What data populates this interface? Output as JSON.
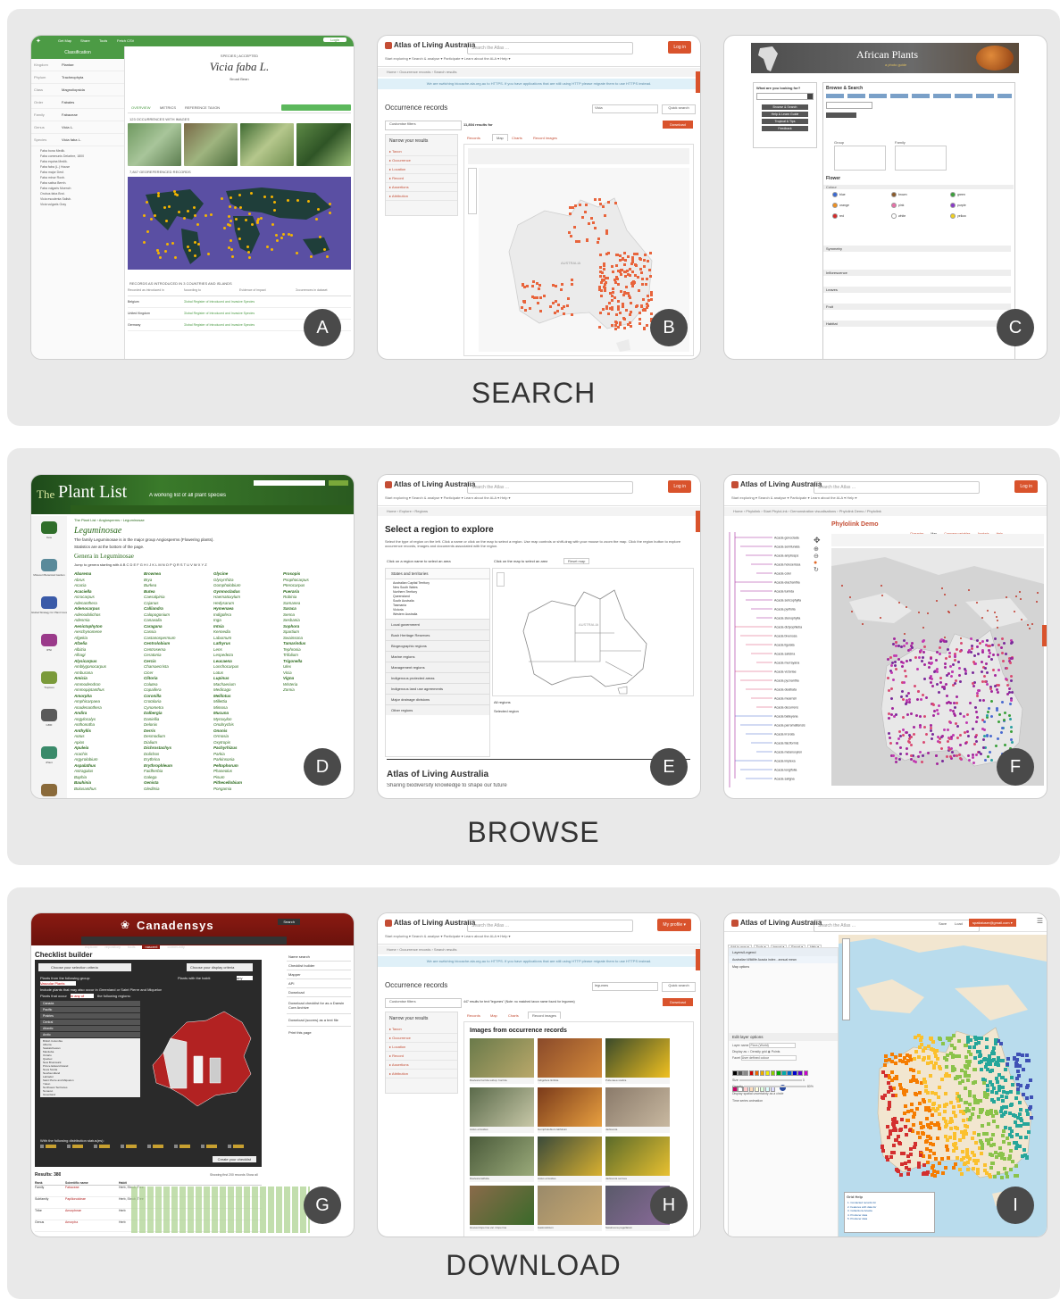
{
  "sections": [
    {
      "caption": "SEARCH"
    },
    {
      "caption": "BROWSE"
    },
    {
      "caption": "DOWNLOAD"
    }
  ],
  "badges": [
    "A",
    "B",
    "C",
    "D",
    "E",
    "F",
    "G",
    "H",
    "I"
  ],
  "A": {
    "toolbar_items": [
      "Get Map",
      "Share",
      "Tools",
      "Fetch CSV"
    ],
    "login_label": "Login",
    "classification_title": "Classification",
    "rank_rows": [
      "Kingdom",
      "Phylum",
      "Class",
      "Order",
      "Family",
      "Genus",
      "Species"
    ],
    "rank_values": [
      "Plantae",
      "Tracheophyta",
      "Magnoliopsida",
      "Fabales",
      "Fabaceae",
      "Vicia L.",
      "Vicia faba L."
    ],
    "status": "SPECIES | ACCEPTED",
    "species_title": "Vicia faba L.",
    "subtitle": "Broad Bean",
    "tabs": [
      "OVERVIEW",
      "METRICS",
      "REFERENCE TAXON"
    ],
    "section_images": "123 OCCURRENCES WITH IMAGES",
    "section_map": "7,847 GEOREFERENCED RECORDS",
    "section_table": "RECORDS AS INTRODUCED IN 3 COUNTRIES AND ISLANDS",
    "table_header": [
      "Recorded as introduced in",
      "According to",
      "Evidence of impact",
      "Occurrences in dataset"
    ],
    "table_rows": [
      [
        "Belgium",
        "Global Register of Introduced and Invasive Species"
      ],
      [
        "United Kingdom",
        "Global Register of Introduced and Invasive Species"
      ],
      [
        "Germany",
        "Global Register of Introduced and Invasive Species"
      ]
    ],
    "synonym_list": [
      "Faba bona Medik.",
      "Faba communis Delarbre, 1800",
      "Faba equina Medik.",
      "Faba faba (L.) House",
      "Faba major Desf.",
      "Faba minor Roxb.",
      "Faba sativa Bernh.",
      "Faba vulgaris Moench",
      "Orobus faba Brot.",
      "Vicia esculenta Salisb.",
      "Vicia vulgaris Gray"
    ]
  },
  "B": {
    "logo": "Atlas of Living Australia",
    "search_placeholder": "Search the Atlas ...",
    "login_btn": "Log in",
    "nav": "Start exploring ▾   Search & analyse ▾   Participate ▾   Learn about the ALA ▾   Help ▾",
    "crumb": "Home  ›  Occurrence records  ›  Search results",
    "notice": "We are switching biocache.ala.org.au to HTTPS. If you have applications that are still using HTTP please migrate them to use HTTPS instead.",
    "title": "Occurrence records",
    "search_value": "Vicia",
    "quick_search": "Quick search",
    "customise": "Customise filters",
    "results": "11,804 results for",
    "download": "Download",
    "narrow": "Narrow your results",
    "facets": [
      "Taxon",
      "Occurrence",
      "Location",
      "Record",
      "Assertions",
      "Attribution"
    ],
    "tabs": [
      "Records",
      "Map",
      "Charts",
      "Record images"
    ],
    "map_label": "AUSTRALIA"
  },
  "C": {
    "banner": "African Plants",
    "banner_sub": "a photo guide",
    "question": "What are you looking for?",
    "buttons": [
      "Browse & Search",
      "Help & Learn Guide",
      "Tropical & Tips",
      "Feedback"
    ],
    "browse_title": "Browse & Search",
    "group_label": "Group",
    "family_label": "Family",
    "flower_label": "Flower",
    "colour_label": "Colour",
    "colours": [
      "blue",
      "brown",
      "green",
      "orange",
      "pink",
      "purple",
      "red",
      "white",
      "yellow"
    ],
    "rows": [
      "Symmetry",
      "Inflorescence",
      "Leaves",
      "Fruit",
      "Habitat"
    ],
    "fruit_label": "Fruit"
  },
  "D": {
    "title_the": "The",
    "title_main": "Plant List",
    "tagline": "A working list of all plant species",
    "nav": [
      "Home",
      "About",
      "Browse",
      "Statistics",
      "Feedback",
      "How to use this site"
    ],
    "crumb": "The Plant List  ›  Angiosperms  ›  Leguminosae",
    "family": "Leguminosae",
    "family_desc": "The family Leguminosae is in the major group Angiosperms (Flowering plants).",
    "stats": "Statistics are at the bottom of the page.",
    "genera_title": "Genera in Leguminosae",
    "jump": "Jump to genera starting with A B C D E F G H I J K L M N O P Q R S T U V W X Y Z",
    "genera_cols": [
      [
        "Abarema",
        "Abrus",
        "Acacia",
        "Acaciella",
        "Acrocarpus",
        "Adenanthera",
        "Adenocarpus",
        "Adenodolichos",
        "Adesmia",
        "Aenictophyton",
        "Aeschynomene",
        "Afgekia",
        "Afzelia",
        "Albizia",
        "Alhagi",
        "Alysicarpus",
        "Amblygonocarpus",
        "Amburana",
        "Amicia",
        "Ammodendron",
        "Ammopiptanthus",
        "Amorpha",
        "Amphicarpaea",
        "Anadenanthera",
        "Andira",
        "Angylocalyx",
        "Anthonotha",
        "Anthyllis",
        "Aotus",
        "Apios",
        "Apuleia",
        "Arachis",
        "Argyrolobium",
        "Aspalathus",
        "Astragalus",
        "Baphia",
        "Bauhinia",
        "Bolusanthus"
      ],
      [
        "Brownea",
        "Brya",
        "Burkea",
        "Butea",
        "Caesalpinia",
        "Cajanus",
        "Calliandra",
        "Calopogonium",
        "Canavalia",
        "Caragana",
        "Cassia",
        "Castanospermum",
        "Centrolobium",
        "Centrosema",
        "Ceratonia",
        "Cercis",
        "Chamaecrista",
        "Cicer",
        "Clitoria",
        "Colutea",
        "Copaifera",
        "Coronilla",
        "Crotalaria",
        "Cynometra",
        "Dalbergia",
        "Daniellia",
        "Delonix",
        "Derris",
        "Desmodium",
        "Dialium",
        "Dichrostachys",
        "Dolichos",
        "Erythrina",
        "Erythrophleum",
        "Faidherbia",
        "Galega",
        "Genista",
        "Gleditsia"
      ],
      [
        "Glycine",
        "Glycyrrhiza",
        "Gompholobium",
        "Gymnocladus",
        "Haematoxylum",
        "Hedysarum",
        "Hymenaea",
        "Indigofera",
        "Inga",
        "Intsia",
        "Kennedia",
        "Laburnum",
        "Lathyrus",
        "Lens",
        "Lespedeza",
        "Leucaena",
        "Lonchocarpus",
        "Lotus",
        "Lupinus",
        "Machaerium",
        "Medicago",
        "Melilotus",
        "Millettia",
        "Mimosa",
        "Mucuna",
        "Myroxylon",
        "Onobrychis",
        "Ononis",
        "Ormosia",
        "Oxytropis",
        "Pachyrhizus",
        "Parkia",
        "Parkinsonia",
        "Peltophorum",
        "Phaseolus",
        "Pisum",
        "Pithecellobium",
        "Pongamia"
      ],
      [
        "Prosopis",
        "Psophocarpus",
        "Pterocarpus",
        "Pueraria",
        "Robinia",
        "Samanea",
        "Saraca",
        "Senna",
        "Sesbania",
        "Sophora",
        "Spartium",
        "Swainsona",
        "Tamarindus",
        "Tephrosia",
        "Trifolium",
        "Trigonella",
        "Ulex",
        "Vicia",
        "Vigna",
        "Wisteria",
        "Zornia"
      ]
    ],
    "sidebar_labels": [
      "Kew",
      "Missouri Botanical Garden",
      "Global Strategy for Plant Conservation",
      "IPNI",
      "Tropicos",
      "GBIF",
      "iPlant",
      "CBD"
    ]
  },
  "E": {
    "logo": "Atlas of Living Australia",
    "search_placeholder": "Search the Atlas ...",
    "login_btn": "Log in",
    "nav": "Start exploring ▾   Search & analyse ▾   Participate ▾   Learn about the ALA ▾   Help ▾",
    "crumb": "Home  ›  Explore  ›  Regions",
    "title": "Select a region to explore",
    "desc": "Select the type of region on the left. Click a name or click on the map to select a region. Use map controls or shift-drag with your mouse to zoom the map. Click the region button to explore occurrence records, images and documents associated with the region.",
    "radio1": "Click on a region name to select an area",
    "radio2": "Click on the map to select an area",
    "reset": "Reset map",
    "group_open": "States and territories",
    "states": [
      "Australian Capital Territory",
      "New South Wales",
      "Northern Territory",
      "Queensland",
      "South Australia",
      "Tasmania",
      "Victoria",
      "Western Australia"
    ],
    "groups": [
      "Local government",
      "Bush Heritage Reserves",
      "Biogeographic regions",
      "Marine regions",
      "Management regions",
      "Indigenous protected areas",
      "Indigenous land use agreements",
      "Major drainage divisions",
      "Other regions"
    ],
    "layer1": "All regions",
    "layer2": "Selected region",
    "footer_title": "Atlas of Living Australia",
    "footer_sub": "Sharing biodiversity knowledge to shape our future",
    "map_label": "AUSTRALIA"
  },
  "F": {
    "logo": "Atlas of Living Australia",
    "search_placeholder": "Search the Atlas ...",
    "login_btn": "Log in",
    "nav": "Start exploring ▾   Search & analyse ▾   Participate ▾   Learn about the ALA ▾   Help ▾",
    "crumb": "Home  ›  Phylolink  ›  Start PhyloLink  ›  Demonstration visualisations  ›  Phylolink Demo / Phylolink",
    "demo_title": "Phylolink Demo",
    "tabs": [
      "Character",
      "Map",
      "Compare variables",
      "Analysis",
      "Help"
    ],
    "tree_labels": [
      "Acacia gonoclada",
      "Acacia semilunata",
      "Acacia ampliceps",
      "Acacia holosericea",
      "Acacia colei",
      "Acacia elachantha",
      "Acacia tumida",
      "Acacia sericophylla",
      "Acacia pyrifolia",
      "Acacia stenophylla",
      "Acacia dictyophleba",
      "Acacia bivenosa",
      "Acacia ligulata",
      "Acacia salicina",
      "Acacia murrayana",
      "Acacia victoriae",
      "Acacia pycnantha",
      "Acacia dealbata",
      "Acacia mearnsii",
      "Acacia decurrens",
      "Acacia baileyana",
      "Acacia parramattensis",
      "Acacia irrorata",
      "Acacia falciformis",
      "Acacia melanoxylon",
      "Acacia implexa",
      "Acacia longifolia",
      "Acacia saligna"
    ]
  },
  "G": {
    "brand": "Canadensys",
    "search_btn": "Search",
    "nav": [
      "explorer",
      "repository",
      "tools",
      "nascent",
      "community"
    ],
    "title": "Checklist builder",
    "step1": "Choose your selection criteria",
    "step2": "Choose your display criteria",
    "plants_group": "Plants from the following group:",
    "group_value": "Vascular Plants",
    "habit": "Plants with the habit:",
    "habit_value": "any",
    "include": "Include plants that may also occur in Greenland or Saint Pierre and Miquelon",
    "occur": "Plants that occur",
    "occur_value": "in any of",
    "occur_tail": "the following regions:",
    "regions": [
      "Canada",
      "Pacific",
      "Prairies",
      "Central",
      "Atlantic",
      "Arctic"
    ],
    "provinces": [
      "British Columbia",
      "Alberta",
      "Saskatchewan",
      "Manitoba",
      "Ontario",
      "Quebec",
      "New Brunswick",
      "Prince Edward Island",
      "Nova Scotia",
      "Newfoundland",
      "Labrador",
      "Saint Pierre and Miquelon",
      "Yukon",
      "Northwest Territories",
      "Nunavut",
      "Greenland"
    ],
    "distribution": "With the following distribution status(es):",
    "create_btn": "Create your checklist",
    "results": "Results: 380",
    "showing": "Showing first 200 records  Show all",
    "table_header": [
      "Rank",
      "Scientific name",
      "Habit"
    ],
    "table_rows": [
      [
        "Family",
        "Fabaceae",
        "Herb, Shrub, Tree"
      ],
      [
        "Subfamily",
        "Papilionoideae",
        "Herb, Shrub, Tree"
      ],
      [
        "Tribe",
        "Amorpheae",
        "Herb"
      ],
      [
        "Genus",
        "Amorpha",
        "Herb"
      ]
    ],
    "right_links": [
      "Name search",
      "Checklist builder",
      "Mapper",
      "API",
      "Download"
    ],
    "download_archive": "Download checklist for as a Darwin Core Archive",
    "download_text": "Download (scores) as a text file",
    "print": "Print this page"
  },
  "H": {
    "logo": "Atlas of Living Australia",
    "search_placeholder": "Search the Atlas ...",
    "profile_btn": "My profile ▾",
    "nav": "Start exploring ▾   Search & analyse ▾   Participate ▾   Learn about the ALA ▾   Help ▾",
    "crumb": "Home  ›  Occurrence records  ›  Search results",
    "notice": "We are switching biocache.ala.org.au to HTTPS. If you have applications that are still using HTTP please migrate them to use HTTPS instead.",
    "title": "Occurrence records",
    "search_value": "legumes",
    "quick_search": "Quick search",
    "customise": "Customise filters",
    "results": "447 results for text:\"legumes\"  (Note: no matched taxon name found for legumes)",
    "download": "Download",
    "narrow": "Narrow your results",
    "facets": [
      "Taxon",
      "Occurrence",
      "Location",
      "Record",
      "Assertions",
      "Attribution"
    ],
    "tabs": [
      "Records",
      "Map",
      "Charts",
      "Record images"
    ],
    "images_title": "Images from occurrence records",
    "captions": [
      "Daviesia horrida subsp. horrida",
      "Indigofera linifolia",
      "Pultenaea scabra",
      "Aotus ericoides",
      "Gompholobium latifolium",
      "Jacksonia",
      "Daviesia latifolia",
      "Aotus ericoides",
      "Jacksonia sericea",
      "Hovea trisperma var. trisperma",
      "Gastrolobium",
      "Swainsona pagellatum"
    ]
  },
  "I": {
    "logo": "Atlas of Living Australia",
    "search_placeholder": "Search the Atlas ...",
    "links": [
      "Save",
      "Load"
    ],
    "user": "spatialuser@gmail.com ▾",
    "menu": [
      "Add to map ▾",
      "Tools ▾",
      "Import ▾",
      "Export ▾",
      "Help ▾"
    ],
    "layer_header": "Layers/Legend",
    "layer1": "Australian Wildlife Acacia index - annual mean",
    "layer2": "Map options",
    "edit_title": "Edit layer options",
    "layer_name_label": "Layer name",
    "layer_name": "Flora (World)",
    "display_label": "Display as",
    "display_opts": [
      "Density grid",
      "Points"
    ],
    "facet_label": "Facet",
    "facet_value": "User defined colour",
    "size_label": "Size",
    "size_value": "3",
    "opacity_label": "Opacity",
    "opacity_value": "80%",
    "uncertainty": "Display spatial uncertainty as a circle",
    "time_series": "Time series animation",
    "legend_title": "Grid Help",
    "legend_lines": [
      "1. Contacted records for",
      "2. Features with data for",
      "3. Collections Acacia",
      "4. Producer data",
      "5. Producer data"
    ]
  }
}
